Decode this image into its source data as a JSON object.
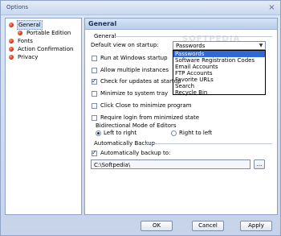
{
  "window": {
    "title": "Options",
    "close_glyph": "×"
  },
  "tree": {
    "items": [
      {
        "label": "General",
        "selected": true
      },
      {
        "label": "Portable Edition"
      },
      {
        "label": "Fonts"
      },
      {
        "label": "Action Confirmation"
      },
      {
        "label": "Privacy"
      }
    ]
  },
  "panel": {
    "header": "General",
    "general_group": "General",
    "default_view_label": "Default view on startup:",
    "default_view_value": "Passwords",
    "dropdown_options": [
      "Passwords",
      "Software Registration Codes",
      "Email Accounts",
      "FTP Accounts",
      "Favorite URLs",
      "Search",
      "Recycle Bin"
    ],
    "checkboxes": {
      "run_at_startup": {
        "label": "Run at Windows startup",
        "checked": false
      },
      "allow_multiple": {
        "label": "Allow multiple instances",
        "checked": false
      },
      "check_updates": {
        "label": "Check for updates at startup",
        "checked": true
      },
      "minimize_tray": {
        "label": "Minimize to system tray",
        "checked": false
      },
      "click_close": {
        "label": "Click Close to minimize program",
        "checked": false
      },
      "require_login": {
        "label": "Require login from minimized state",
        "checked": false
      }
    },
    "bidi_label": "Bidirectional Mode of Editors",
    "radio_ltr": "Left to right",
    "radio_rtl": "Right to left",
    "backup_group": "Automatically Backup",
    "auto_backup_label": "Automatically backup to:",
    "backup_path": "C:\\Softpedia\\",
    "browse_label": "..."
  },
  "buttons": {
    "ok": "OK",
    "cancel": "Cancel",
    "apply": "Apply"
  },
  "colors": {
    "accent": "#3168d5",
    "node_dot": "#d4331a"
  }
}
